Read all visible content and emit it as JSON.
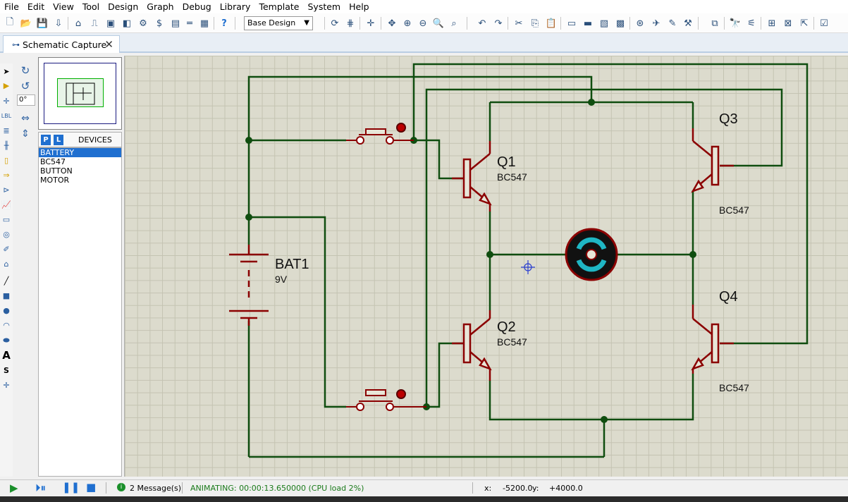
{
  "menu": [
    "File",
    "Edit",
    "View",
    "Tool",
    "Design",
    "Graph",
    "Debug",
    "Library",
    "Template",
    "System",
    "Help"
  ],
  "toolbar": {
    "design_select": "Base Design"
  },
  "tab": {
    "label": "Schematic Capture"
  },
  "rotation": {
    "angle": "0°"
  },
  "devices": {
    "header": "DEVICES",
    "p_label": "P",
    "l_label": "L",
    "items": [
      "BATTERY",
      "BC547",
      "BUTTON",
      "MOTOR"
    ],
    "selected_index": 0
  },
  "schematic": {
    "battery": {
      "ref": "BAT1",
      "value": "9V"
    },
    "transistors": [
      {
        "ref": "Q1",
        "value": "BC547"
      },
      {
        "ref": "Q2",
        "value": "BC547"
      },
      {
        "ref": "Q3",
        "value": "BC547"
      },
      {
        "ref": "Q4",
        "value": "BC547"
      }
    ],
    "wire_color": "#0f4d0f",
    "component_color": "#8b0000"
  },
  "status": {
    "messages": "2 Message(s)",
    "animation": "ANIMATING: 00:00:13.650000 (CPU load 2%)",
    "x_label": "x:",
    "x_value": "-5200.0",
    "y_label": "y:",
    "y_value": "+4000.0"
  }
}
